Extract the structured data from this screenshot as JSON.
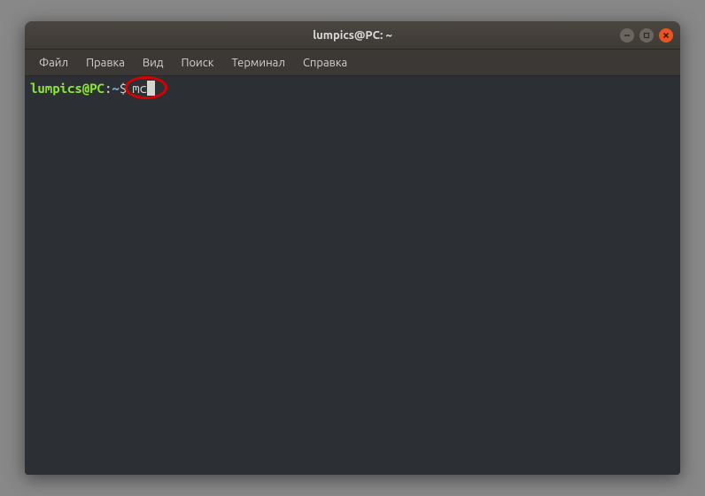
{
  "window": {
    "title": "lumpics@PC: ~"
  },
  "menubar": {
    "items": [
      {
        "label": "Файл"
      },
      {
        "label": "Правка"
      },
      {
        "label": "Вид"
      },
      {
        "label": "Поиск"
      },
      {
        "label": "Терминал"
      },
      {
        "label": "Справка"
      }
    ]
  },
  "terminal": {
    "prompt_user": "lumpics@PC",
    "prompt_sep": ":",
    "prompt_path": "~",
    "prompt_symbol": "$",
    "command": "mc"
  },
  "colors": {
    "prompt_user": "#8ae234",
    "prompt_path": "#729fcf",
    "text": "#d3d7cf",
    "bg": "#2c2f33",
    "highlight": "#d90000",
    "close_btn": "#e95420"
  }
}
